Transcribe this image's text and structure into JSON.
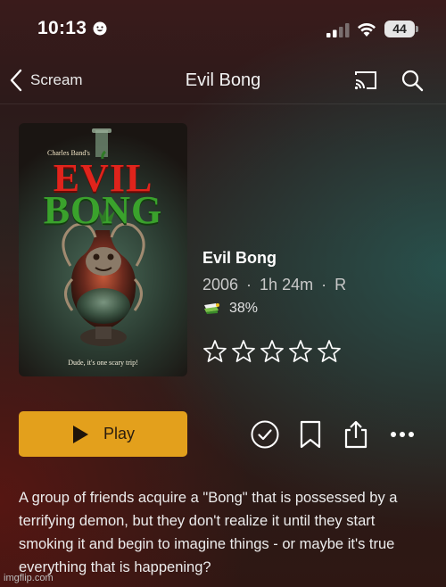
{
  "status_bar": {
    "time": "10:13",
    "battery": "44"
  },
  "nav": {
    "back_label": "Scream",
    "title": "Evil Bong"
  },
  "poster": {
    "credit": "Charles Band's",
    "title_line1": "EVIL",
    "title_line2": "BONG",
    "tagline": "Dude, it's one scary trip!"
  },
  "movie": {
    "title": "Evil Bong",
    "year": "2006",
    "runtime": "1h 24m",
    "rating": "R",
    "score": "38%",
    "user_rating_stars": 0,
    "max_stars": 5
  },
  "actions": {
    "play_label": "Play"
  },
  "description": "A group of friends acquire a \"Bong\" that is possessed by a terrifying demon, but they don't realize it until they start smoking it and begin to imagine things - or maybe it's true everything that is happening?",
  "watermark": "imgflip.com",
  "colors": {
    "play_button": "#e3a01c",
    "title_red": "#e0241c",
    "title_green": "#3aa22c"
  },
  "icons": [
    "back-chevron-icon",
    "cast-icon",
    "search-icon",
    "popcorn-score-icon",
    "star-icon",
    "play-icon",
    "checkmark-circle-icon",
    "bookmark-icon",
    "share-icon",
    "more-icon"
  ]
}
